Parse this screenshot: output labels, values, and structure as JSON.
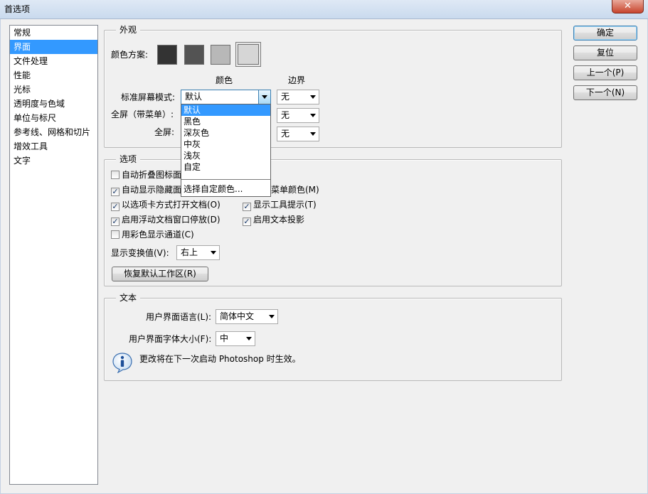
{
  "window": {
    "title": "首选项",
    "close_glyph": "✕"
  },
  "categories": [
    {
      "label": "常规"
    },
    {
      "label": "界面"
    },
    {
      "label": "文件处理"
    },
    {
      "label": "性能"
    },
    {
      "label": "光标"
    },
    {
      "label": "透明度与色域"
    },
    {
      "label": "单位与标尺"
    },
    {
      "label": "参考线、网格和切片"
    },
    {
      "label": "增效工具"
    },
    {
      "label": "文字"
    }
  ],
  "selected_category": "界面",
  "appearance": {
    "group_title": "外观",
    "color_scheme_label": "颜色方案:",
    "swatch_colors": [
      "#333333",
      "#535353",
      "#b8b8b8",
      "#d6d6d6"
    ],
    "col_color": "颜色",
    "col_border": "边界",
    "std_mode_label": "标准屏幕模式:",
    "std_mode_value": "默认",
    "std_border_value": "无",
    "fullmenu_label": "全屏（带菜单）:",
    "fullmenu_border_value": "无",
    "full_label": "全屏:",
    "full_border_value": "无"
  },
  "dropdown": {
    "items": [
      "默认",
      "黑色",
      "深灰色",
      "中灰",
      "浅灰",
      "自定"
    ],
    "selected": "默认",
    "custom": "选择自定颜色..."
  },
  "options": {
    "group_title": "选项",
    "auto_collapse": "自动折叠图标面",
    "auto_show_hidden": "自动显示隐藏面",
    "menu_colors_tail": "菜单颜色(M)",
    "open_tabs": "以选项卡方式打开文档(O)",
    "tooltips": "显示工具提示(T)",
    "float_dock": "启用浮动文档窗口停放(D)",
    "text_shadow": "启用文本投影",
    "color_channels": "用彩色显示通道(C)",
    "transform_label": "显示变换值(V):",
    "transform_value": "右上",
    "reset_workspace": "恢复默认工作区(R)",
    "checked_glyph": "✓"
  },
  "text": {
    "group_title": "文本",
    "ui_language_label": "用户界面语言(L):",
    "ui_language_value": "简体中文",
    "ui_font_label": "用户界面字体大小(F):",
    "ui_font_value": "中",
    "notice": "更改将在下一次启动 Photoshop 时生效。"
  },
  "buttons": {
    "ok": "确定",
    "reset": "复位",
    "prev": "上一个(P)",
    "next": "下一个(N)"
  }
}
